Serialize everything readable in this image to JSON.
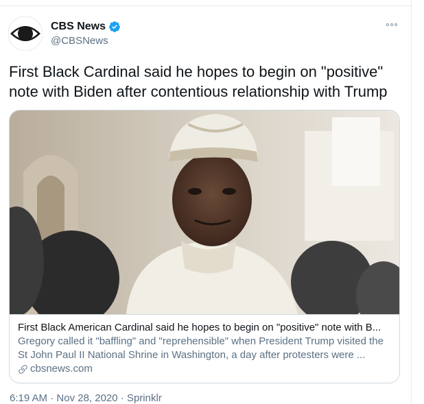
{
  "author": {
    "name": "CBS News",
    "handle": "@CBSNews",
    "avatar_icon": "cbs-eye-logo",
    "verified_icon": "verified-badge-icon",
    "verified_color": "#1da1f2"
  },
  "tweet": {
    "text": "First Black Cardinal said he hopes to begin on \"positive\" note with Biden after contentious relationship with Trump"
  },
  "card": {
    "title": "First Black American Cardinal said he hopes to begin on \"positive\" note with B...",
    "description": "Gregory called it \"baffling\" and \"reprehensible\" when President Trump visited the St John Paul II National Shrine in Washington, a day after protesters were ...",
    "domain": "cbsnews.com",
    "link_icon": "link-icon"
  },
  "meta": {
    "time": "6:19 AM",
    "sep1": "·",
    "date": "Nov 28, 2020",
    "sep2": "·",
    "source": "Sprinklr"
  },
  "colors": {
    "text": "#0f1419",
    "secondary": "#5b7083",
    "border": "#cfd9de"
  }
}
